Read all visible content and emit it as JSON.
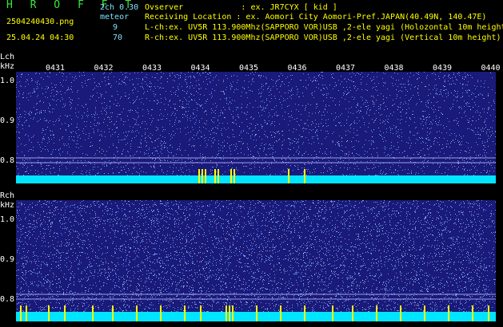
{
  "header": {
    "app_title": "H R O F F T",
    "version": "2ch 0.30",
    "filename": "2504240430.png",
    "meteor_label": "meteor",
    "lch_count": "9",
    "rch_count": "70",
    "datetime": "25.04.24 04:30",
    "observer": "Ovserver            : ex. JR7CYX [ kid ]",
    "location": "Receiving Location : ex. Aomori City Aomori-Pref.JAPAN(40.49N, 140.47E)",
    "lch_info": "L-ch:ex. UV5R 113.900Mhz(SAPPORO VOR)USB ,2-ele yagi (Holozontal 10m height)",
    "rch_info": "R-ch:ex. UV5R 113.900Mhz(SAPPORO VOR)USB ,2-ele yagi (Vertical 10m height)"
  },
  "lch": {
    "label": "Lch",
    "unit": "kHz",
    "y_ticks": [
      "1.0",
      "0.9",
      "0.8"
    ]
  },
  "rch": {
    "label": "Rch",
    "unit": "kHz",
    "y_ticks": [
      "1.0",
      "0.9",
      "0.8"
    ]
  },
  "time_ticks": [
    "0431",
    "0432",
    "0433",
    "0434",
    "0435",
    "0436",
    "0437",
    "0438",
    "0439",
    "0440"
  ],
  "colors": {
    "background": "#000000",
    "spectrogram": "#1a1a7a",
    "noise_dot": "#6fa8ff",
    "baseline": "#00e5ff",
    "meteor": "#ffff00",
    "guide_line": "#c0c0ff"
  }
}
